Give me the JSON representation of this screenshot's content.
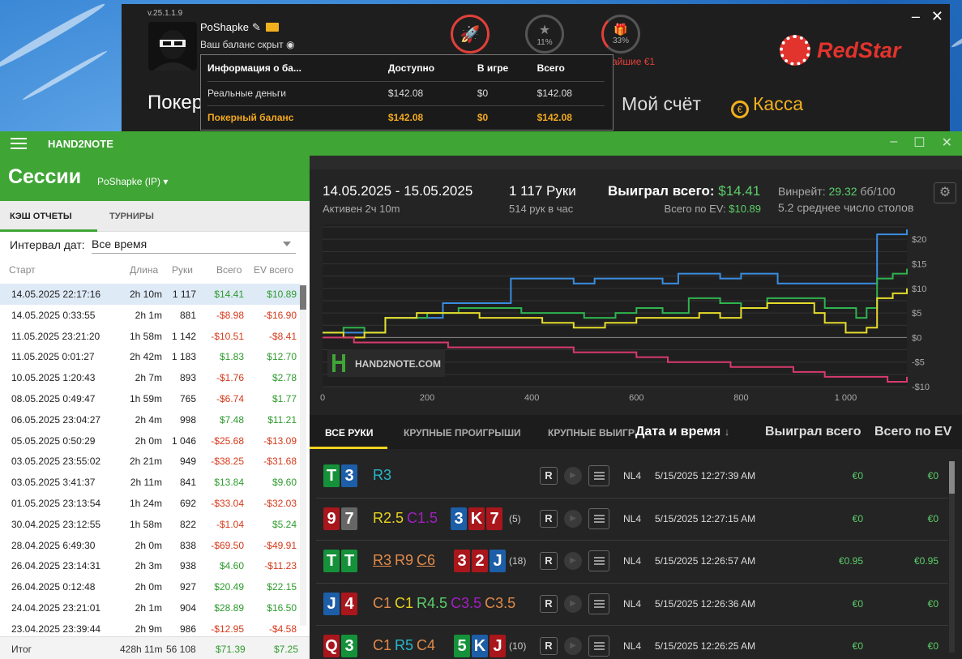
{
  "casino": {
    "version": "v.25.1.1.9",
    "username": "PoShapke",
    "balance_label": "Ваш баланс скрыт",
    "progress1": "11%",
    "progress2": "33%",
    "bonus_text": "айшие €1",
    "brand": "RedStar",
    "nav_poker": "Покер",
    "nav_account": "Мой счёт",
    "nav_cashier": "Касса",
    "popup": {
      "headers": [
        "Информация о ба...",
        "Доступно",
        "В игре",
        "Всего"
      ],
      "rows": [
        [
          "Реальные деньги",
          "$142.08",
          "$0",
          "$142.08"
        ],
        [
          "Покерный баланс",
          "$142.08",
          "$0",
          "$142.08"
        ]
      ]
    }
  },
  "h2n": {
    "app_title": "HAND2NOTE",
    "sessions_title": "Сессии",
    "session_user": "PoShapke (IP)",
    "tab_cash": "КЭШ ОТЧЕТЫ",
    "tab_tournaments": "ТУРНИРЫ",
    "interval_label": "Интервал дат:",
    "interval_value": "Все время",
    "columns": [
      "Старт",
      "Длина",
      "Руки",
      "Всего",
      "EV всего"
    ],
    "sessions": [
      [
        "14.05.2025 22:17:16",
        "2h 10m",
        "1 117",
        "$14.41",
        "$10.89"
      ],
      [
        "14.05.2025 0:33:55",
        "2h 1m",
        "881",
        "-$8.98",
        "-$16.90"
      ],
      [
        "11.05.2025 23:21:20",
        "1h 58m",
        "1 142",
        "-$10.51",
        "-$8.41"
      ],
      [
        "11.05.2025 0:01:27",
        "2h 42m",
        "1 183",
        "$1.83",
        "$12.70"
      ],
      [
        "10.05.2025 1:20:43",
        "2h 7m",
        "893",
        "-$1.76",
        "$2.78"
      ],
      [
        "08.05.2025 0:49:47",
        "1h 59m",
        "765",
        "-$6.74",
        "$1.77"
      ],
      [
        "06.05.2025 23:04:27",
        "2h 4m",
        "998",
        "$7.48",
        "$11.21"
      ],
      [
        "05.05.2025 0:50:29",
        "2h 0m",
        "1 046",
        "-$25.68",
        "-$13.09"
      ],
      [
        "03.05.2025 23:55:02",
        "2h 21m",
        "949",
        "-$38.25",
        "-$31.68"
      ],
      [
        "03.05.2025 3:41:37",
        "2h 11m",
        "841",
        "$13.84",
        "$9.60"
      ],
      [
        "01.05.2025 23:13:54",
        "1h 24m",
        "692",
        "-$33.04",
        "-$32.03"
      ],
      [
        "30.04.2025 23:12:55",
        "1h 58m",
        "822",
        "-$1.04",
        "$5.24"
      ],
      [
        "28.04.2025 6:49:30",
        "2h 0m",
        "838",
        "-$69.50",
        "-$49.91"
      ],
      [
        "26.04.2025 23:14:31",
        "2h 3m",
        "938",
        "$4.60",
        "-$11.23"
      ],
      [
        "26.04.2025 0:12:48",
        "2h 0m",
        "927",
        "$20.49",
        "$22.15"
      ],
      [
        "24.04.2025 23:21:01",
        "2h 1m",
        "904",
        "$28.89",
        "$16.50"
      ],
      [
        "23.04.2025 23:39:44",
        "2h 9m",
        "986",
        "-$12.95",
        "-$4.58"
      ]
    ],
    "total": [
      "Итог",
      "428h 11m",
      "56 108",
      "$71.39",
      "$7.25"
    ],
    "summary": {
      "range": "14.05.2025 - 15.05.2025",
      "active": "Активен 2ч 10m",
      "hands": "1 117 Руки",
      "hands_per_hour": "514 рук в час",
      "won_label": "Выиграл всего:",
      "won_value": "$14.41",
      "ev_label": "Всего по EV:",
      "ev_value": "$10.89",
      "winrate_label": "Винрейт:",
      "winrate_value": "29.32",
      "winrate_unit": "бб/100",
      "tables": "5.2 среднее число столов"
    },
    "hand_tabs": [
      "ВСЕ РУКИ",
      "КРУПНЫЕ ПРОИГРЫШИ",
      "КРУПНЫЕ ВЫИГРЫШИ"
    ],
    "hand_cols": [
      "Дата и время",
      "Выиграл всего",
      "Всего по EV"
    ],
    "hands_list": [
      {
        "cards": [
          [
            "T",
            "cg"
          ],
          [
            "3",
            "cb"
          ]
        ],
        "actions": [
          [
            "R3",
            "#29b6c8",
            false
          ]
        ],
        "board": [],
        "board_n": "",
        "limit": "NL4",
        "dt": "5/15/2025 12:27:39 AM",
        "won": "€0",
        "ev": "€0"
      },
      {
        "cards": [
          [
            "9",
            "cr2"
          ],
          [
            "7",
            "cy"
          ]
        ],
        "actions": [
          [
            "R2.5",
            "#e6d21e",
            false
          ],
          [
            "C1.5",
            "#a020c0",
            false
          ]
        ],
        "board": [
          [
            "3",
            "cb"
          ],
          [
            "K",
            "cr2"
          ],
          [
            "7",
            "cr2"
          ]
        ],
        "board_n": "(5)",
        "limit": "NL4",
        "dt": "5/15/2025 12:27:15 AM",
        "won": "€0",
        "ev": "€0"
      },
      {
        "cards": [
          [
            "T",
            "cg"
          ],
          [
            "T",
            "cg"
          ]
        ],
        "actions": [
          [
            "R3",
            "#e08a4a",
            true
          ],
          [
            "R9",
            "#e08a4a",
            false
          ],
          [
            "C6",
            "#e08a4a",
            true
          ]
        ],
        "board": [
          [
            "3",
            "cr2"
          ],
          [
            "2",
            "cr2"
          ],
          [
            "J",
            "cb"
          ]
        ],
        "board_n": "(18)",
        "limit": "NL4",
        "dt": "5/15/2025 12:26:57 AM",
        "won": "€0.95",
        "ev": "€0.95"
      },
      {
        "cards": [
          [
            "J",
            "cb"
          ],
          [
            "4",
            "cr2"
          ]
        ],
        "actions": [
          [
            "C1",
            "#e08a4a",
            false
          ],
          [
            "C1",
            "#e6d21e",
            false
          ],
          [
            "R4.5",
            "#5ccf6a",
            false
          ],
          [
            "C3.5",
            "#a020c0",
            false
          ],
          [
            "C3.5",
            "#e08a4a",
            false
          ]
        ],
        "board": [],
        "board_n": "",
        "limit": "NL4",
        "dt": "5/15/2025 12:26:36 AM",
        "won": "€0",
        "ev": "€0"
      },
      {
        "cards": [
          [
            "Q",
            "cr2"
          ],
          [
            "3",
            "cg"
          ]
        ],
        "actions": [
          [
            "C1",
            "#e08a4a",
            false
          ],
          [
            "R5",
            "#29b6c8",
            false
          ],
          [
            "C4",
            "#e08a4a",
            false
          ]
        ],
        "board": [
          [
            "5",
            "cg"
          ],
          [
            "K",
            "cb"
          ],
          [
            "J",
            "cr2"
          ]
        ],
        "board_n": "(10)",
        "limit": "NL4",
        "dt": "5/15/2025 12:26:25 AM",
        "won": "€0",
        "ev": "€0"
      }
    ],
    "btn_r": "R",
    "watermark": "HAND2NOTE.COM"
  },
  "chart_data": {
    "type": "line",
    "x_ticks": [
      0,
      200,
      400,
      600,
      800,
      1000
    ],
    "x_tick_labels": [
      "0",
      "200",
      "400",
      "600",
      "800",
      "1 000"
    ],
    "y_ticks": [
      20,
      15,
      10,
      5,
      0,
      -5,
      -10
    ],
    "y_tick_labels": [
      "$20",
      "$15",
      "$10",
      "$5",
      "$0",
      "-$5",
      "-$10"
    ],
    "xlim": [
      0,
      1117
    ],
    "ylim": [
      -10,
      23
    ],
    "series": [
      {
        "color": "#3a8de0",
        "x": [
          0,
          60,
          90,
          120,
          200,
          230,
          300,
          360,
          360,
          460,
          480,
          520,
          600,
          650,
          680,
          720,
          760,
          800,
          870,
          930,
          1000,
          1060,
          1060,
          1117
        ],
        "y": [
          1,
          1,
          1,
          4,
          4,
          7,
          7,
          8,
          12,
          12,
          11,
          12,
          12,
          11,
          13,
          13,
          12,
          13,
          11,
          11,
          11,
          20,
          21,
          22
        ]
      },
      {
        "color": "#2fb44e",
        "x": [
          0,
          40,
          80,
          120,
          200,
          260,
          320,
          380,
          440,
          500,
          560,
          600,
          650,
          700,
          760,
          800,
          850,
          900,
          960,
          1020,
          1040,
          1060,
          1090,
          1117
        ],
        "y": [
          1,
          2,
          1,
          4,
          5,
          6,
          6,
          5,
          5,
          4,
          5,
          6,
          5,
          8,
          7,
          6,
          8,
          8,
          6,
          4,
          6,
          12,
          13,
          14
        ]
      },
      {
        "color": "#e6dc2c",
        "x": [
          0,
          40,
          80,
          120,
          180,
          240,
          300,
          360,
          420,
          480,
          540,
          600,
          660,
          720,
          760,
          800,
          850,
          900,
          940,
          960,
          1000,
          1040,
          1060,
          1090,
          1117
        ],
        "y": [
          1,
          0,
          1,
          4,
          5,
          5,
          4,
          4,
          3,
          2,
          3,
          4,
          4,
          5,
          4,
          6,
          7,
          7,
          5,
          3,
          1,
          2,
          8,
          9,
          10
        ]
      },
      {
        "color": "#d83a6e",
        "x": [
          0,
          60,
          120,
          180,
          240,
          300,
          360,
          420,
          480,
          540,
          600,
          660,
          720,
          780,
          840,
          900,
          960,
          1020,
          1080,
          1117
        ],
        "y": [
          0,
          -1,
          -1,
          -1,
          -2,
          -2,
          -2,
          -2,
          -3,
          -3,
          -4,
          -5,
          -5,
          -6,
          -6,
          -7,
          -8,
          -8,
          -9,
          -8
        ]
      }
    ]
  }
}
